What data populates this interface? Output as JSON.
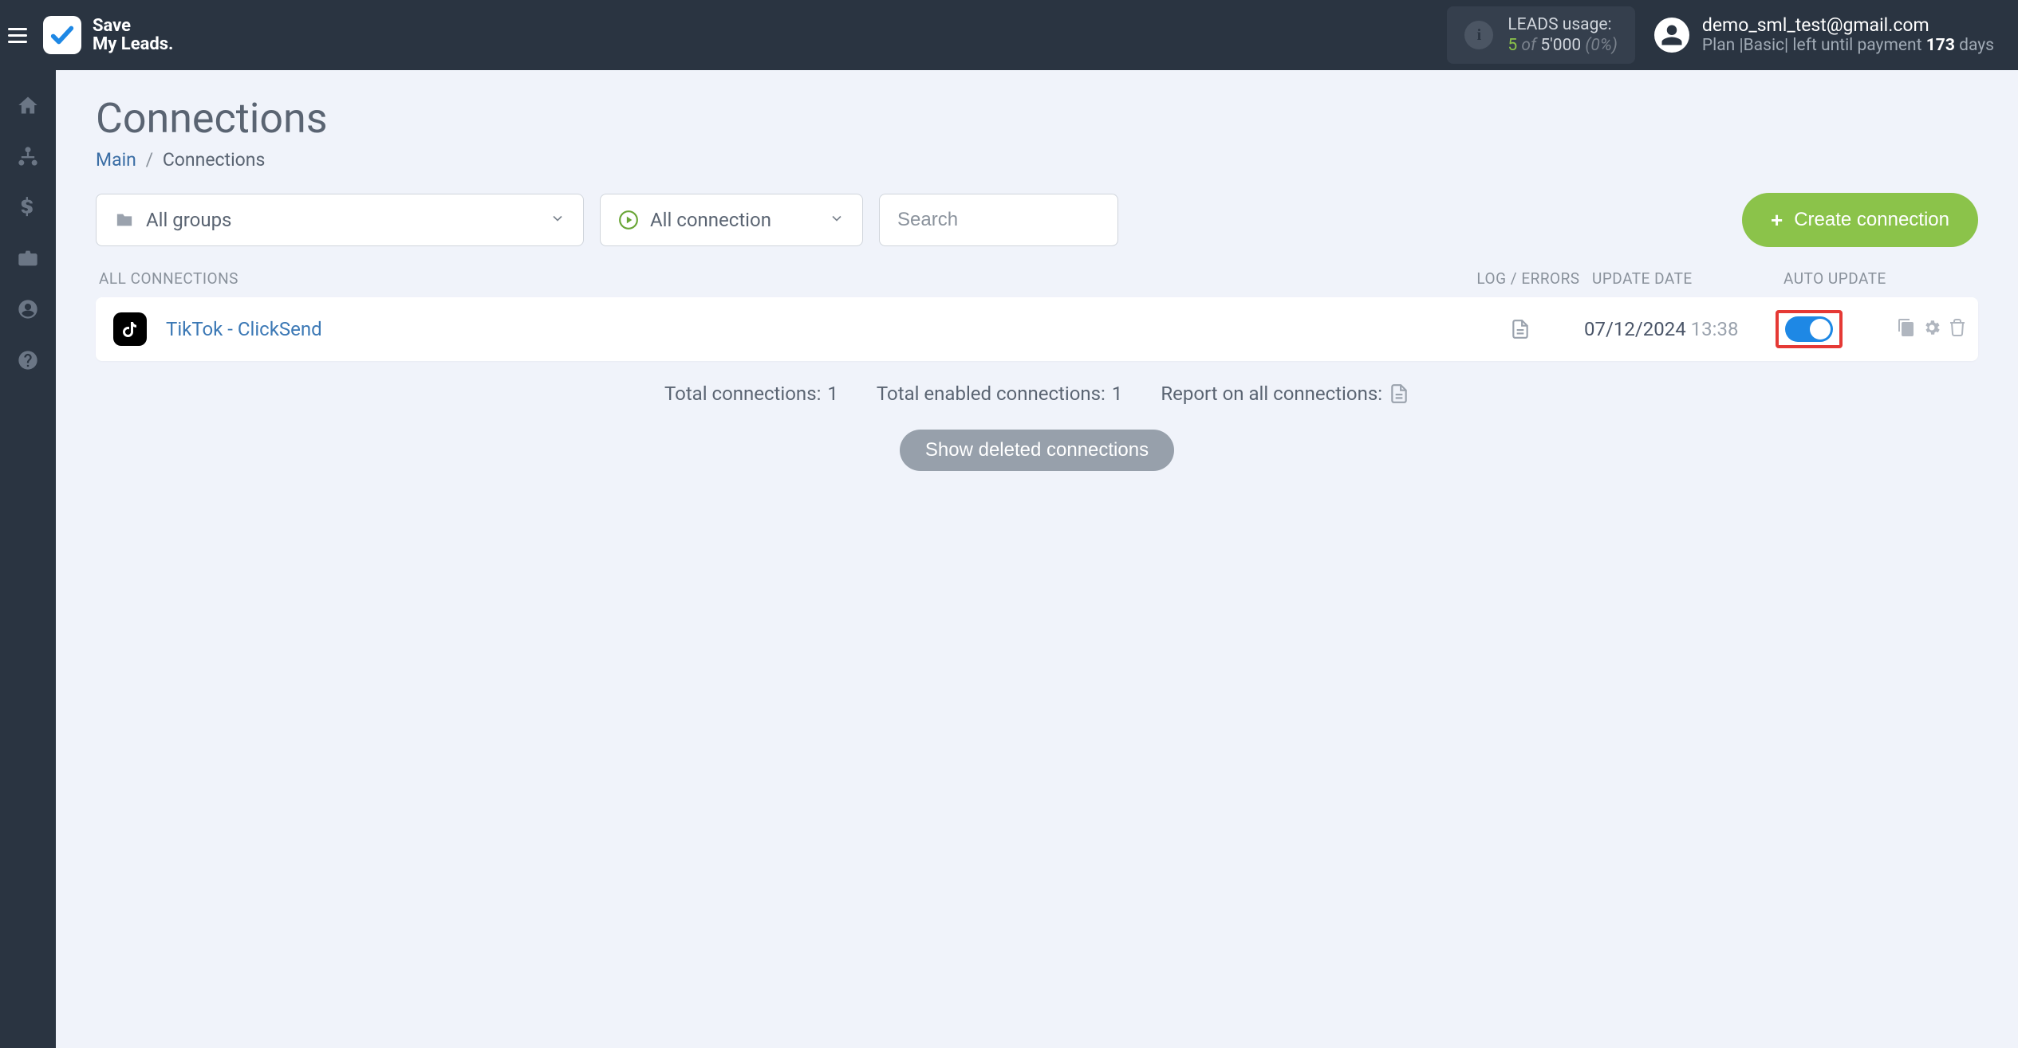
{
  "brand": {
    "line1": "Save",
    "line2": "My Leads."
  },
  "leads_widget": {
    "label": "LEADS usage:",
    "used": "5",
    "of_word": "of",
    "total": "5'000",
    "pct": "(0%)"
  },
  "user": {
    "email": "demo_sml_test@gmail.com",
    "plan_prefix": "Plan",
    "plan_name": "Basic",
    "until_text": "left until payment",
    "days_num": "173",
    "days_word": "days"
  },
  "page": {
    "title": "Connections",
    "breadcrumb_main": "Main",
    "breadcrumb_current": "Connections"
  },
  "filters": {
    "groups_label": "All groups",
    "status_label": "All connection",
    "search_placeholder": "Search"
  },
  "buttons": {
    "create": "Create connection",
    "show_deleted": "Show deleted connections"
  },
  "columns": {
    "name": "ALL CONNECTIONS",
    "log": "LOG / ERRORS",
    "date": "UPDATE DATE",
    "auto": "AUTO UPDATE"
  },
  "row": {
    "name": "TikTok - ClickSend",
    "date": "07/12/2024",
    "time": "13:38",
    "auto_update_on": true
  },
  "summary": {
    "total_label": "Total connections:",
    "total_value": "1",
    "enabled_label": "Total enabled connections:",
    "enabled_value": "1",
    "report_label": "Report on all connections:"
  }
}
